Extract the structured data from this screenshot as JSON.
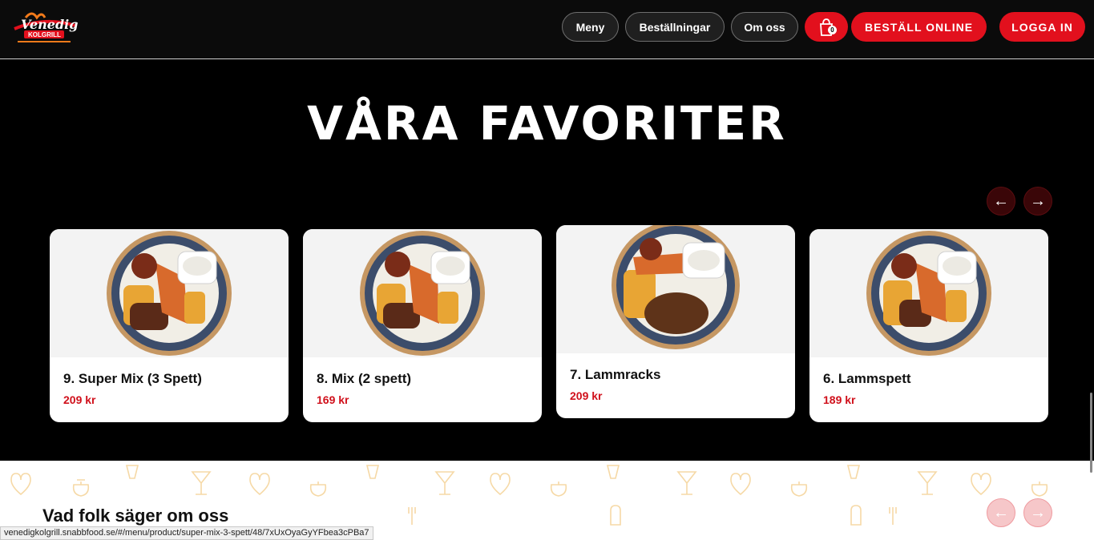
{
  "header": {
    "logo_text": "Venedig KOLGRILL",
    "nav": [
      "Meny",
      "Beställningar",
      "Om oss"
    ],
    "cart_count": "0",
    "order_online": "BESTÄLL ONLINE",
    "login": "LOGGA IN"
  },
  "favorites": {
    "title": "VÅRA FAVORITER",
    "items": [
      {
        "name": "9. Super Mix (3 Spett)",
        "price": "209 kr"
      },
      {
        "name": "8. Mix (2 spett)",
        "price": "169 kr"
      },
      {
        "name": "7. Lammracks",
        "price": "209 kr"
      },
      {
        "name": "6. Lammspett",
        "price": "189 kr"
      }
    ]
  },
  "testimonials": {
    "title": "Vad folk säger om oss"
  },
  "status_url": "venedigkolgrill.snabbfood.se/#/menu/product/super-mix-3-spett/48/7xUxOyaGyYFbea3cPBa7",
  "colors": {
    "accent": "#e2101d",
    "price": "#d0101b",
    "background": "#000000"
  },
  "icons": [
    "cart-icon",
    "arrow-left-icon",
    "arrow-right-icon",
    "food-plate-icon"
  ]
}
